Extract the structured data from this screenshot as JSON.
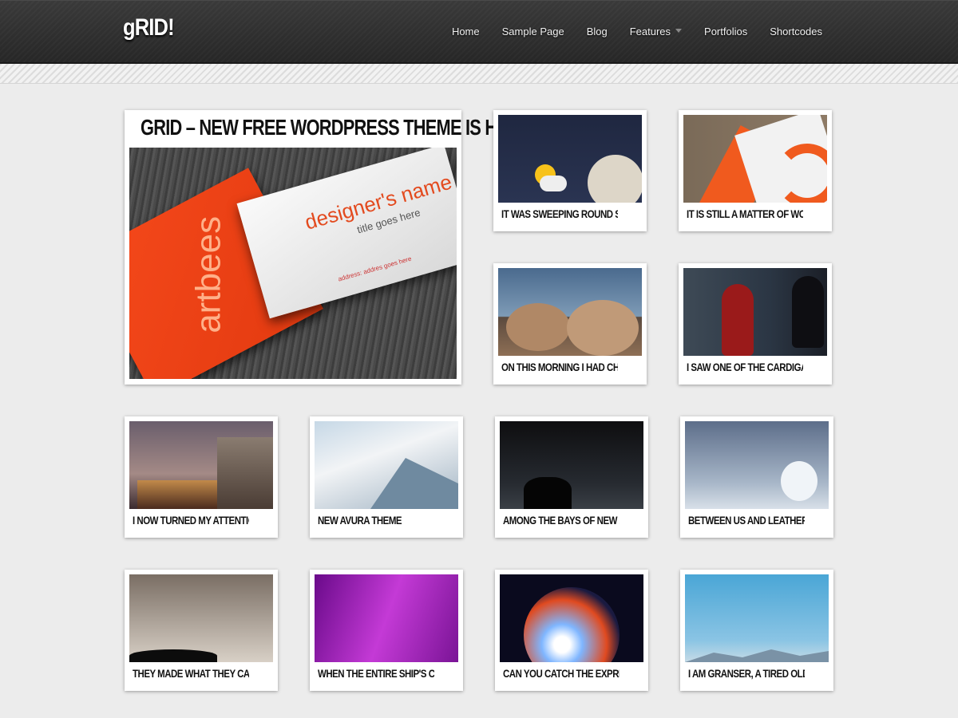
{
  "site": {
    "logo": "gRID!"
  },
  "nav": [
    {
      "label": "Home"
    },
    {
      "label": "Sample Page"
    },
    {
      "label": "Blog"
    },
    {
      "label": "Features",
      "has_dropdown": true
    },
    {
      "label": "Portfolios"
    },
    {
      "label": "Shortcodes"
    }
  ],
  "featured": {
    "title": "GRID – NEW FREE WORDPRESS THEME IS HERE!",
    "image_text": {
      "designer": "designer's name",
      "title": "title goes here",
      "address": "address: addres goes here",
      "brand": "artbees"
    }
  },
  "posts": [
    {
      "caption": "IT WAS SWEEPING ROUND SWIFTLY AND"
    },
    {
      "caption": "IT IS STILL A MATTER OF WONDER"
    },
    {
      "caption": "ON THIS MORNING I HAD CHOSEN A NEW"
    },
    {
      "caption": "I SAW ONE OF THE CARDIGAN MEN"
    },
    {
      "caption": "I NOW TURNED MY ATTENTION..."
    },
    {
      "caption": "NEW AVURA THEME"
    },
    {
      "caption": "AMONG THE BAYS OF NEW ZEALAND"
    },
    {
      "caption": "BETWEEN US AND LEATHERHEAD..."
    },
    {
      "caption": "THEY MADE WHAT THEY CALLED A SERUM"
    },
    {
      "caption": "WHEN THE ENTIRE SHIP'S COMPANY"
    },
    {
      "caption": "CAN YOU CATCH THE EXPRESSION OF THE"
    },
    {
      "caption": "I AM GRANSER, A TIRED OLD MAN"
    }
  ]
}
